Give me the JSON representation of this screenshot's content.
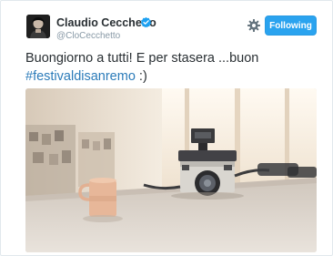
{
  "tweet": {
    "author": {
      "display_name": "Claudio Cecchetto",
      "handle": "@CloCecchetto",
      "verified": true
    },
    "follow_label": "Following",
    "text_before_link": "Buongiorno a tutti! E per stasera ...buon ",
    "hashtag": "#festivaldisanremo",
    "text_after_link": " :)",
    "icons": {
      "verified": "verified-badge-icon",
      "more": "gear-icon",
      "avatar": "user-avatar"
    },
    "colors": {
      "accent": "#2aa3ef",
      "link": "#2b7bb9",
      "name": "#292f33",
      "handle": "#8899a6"
    }
  }
}
